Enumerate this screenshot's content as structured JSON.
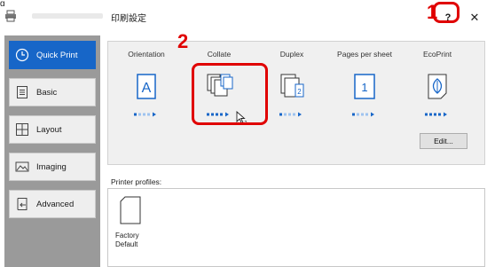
{
  "corner_mark": "g",
  "window": {
    "title": "印刷設定",
    "help_label": "?",
    "close_label": "✕",
    "app_icon": "printer-icon"
  },
  "callouts": {
    "one": "1",
    "two": "2",
    "color": "#e00000"
  },
  "sidebar": {
    "items": [
      {
        "label": "Quick Print",
        "icon": "clock-icon",
        "active": true
      },
      {
        "label": "Basic",
        "icon": "document-lines-icon",
        "active": false
      },
      {
        "label": "Layout",
        "icon": "grid-icon",
        "active": false
      },
      {
        "label": "Imaging",
        "icon": "image-icon",
        "active": false
      },
      {
        "label": "Advanced",
        "icon": "page-arrow-icon",
        "active": false
      }
    ],
    "accent": "#1766c8",
    "background": "#9a9a9a"
  },
  "settings": [
    {
      "label": "Orientation",
      "icon": "portrait-page-icon",
      "level": 0
    },
    {
      "label": "Collate",
      "icon": "collate-icon",
      "level": 3
    },
    {
      "label": "Duplex",
      "icon": "duplex-icon",
      "level": 0
    },
    {
      "label": "Pages per sheet",
      "icon": "one-page-icon",
      "level": 0
    },
    {
      "label": "EcoPrint",
      "icon": "leaf-icon",
      "level": 3
    }
  ],
  "edit_button": "Edit...",
  "printer_profiles": {
    "label": "Printer profiles:",
    "items": [
      {
        "label_line1": "Factory",
        "label_line2": "Default"
      }
    ]
  },
  "colors": {
    "icon_blue": "#1766c8",
    "dot_inactive": "#9ec3ef"
  }
}
